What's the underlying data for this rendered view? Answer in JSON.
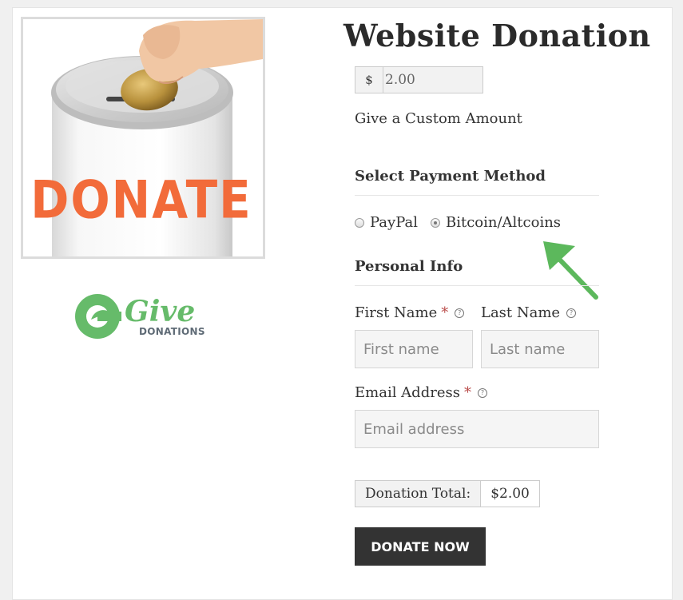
{
  "form": {
    "title": "Website Donation",
    "currency_symbol": "$",
    "amount_value": "2.00",
    "custom_amount_label": "Give a Custom Amount"
  },
  "image": {
    "can_text": "DONATE",
    "icon": "coin-donation-can"
  },
  "logo": {
    "word": "Give",
    "sub": "DONATIONS",
    "color": "#66bb6a"
  },
  "payment": {
    "heading": "Select Payment Method",
    "options": [
      {
        "label": "PayPal",
        "selected": false
      },
      {
        "label": "Bitcoin/Altcoins",
        "selected": true
      }
    ]
  },
  "personal": {
    "heading": "Personal Info",
    "first_name": {
      "label": "First Name",
      "required_mark": "*",
      "placeholder": "First name"
    },
    "last_name": {
      "label": "Last Name",
      "placeholder": "Last name"
    },
    "email": {
      "label": "Email Address",
      "required_mark": "*",
      "placeholder": "Email address"
    }
  },
  "total": {
    "label": "Donation Total:",
    "value": "$2.00"
  },
  "donate_button": "DONATE NOW",
  "annotation": {
    "icon": "green-arrow-icon",
    "color": "#5cb85c"
  }
}
